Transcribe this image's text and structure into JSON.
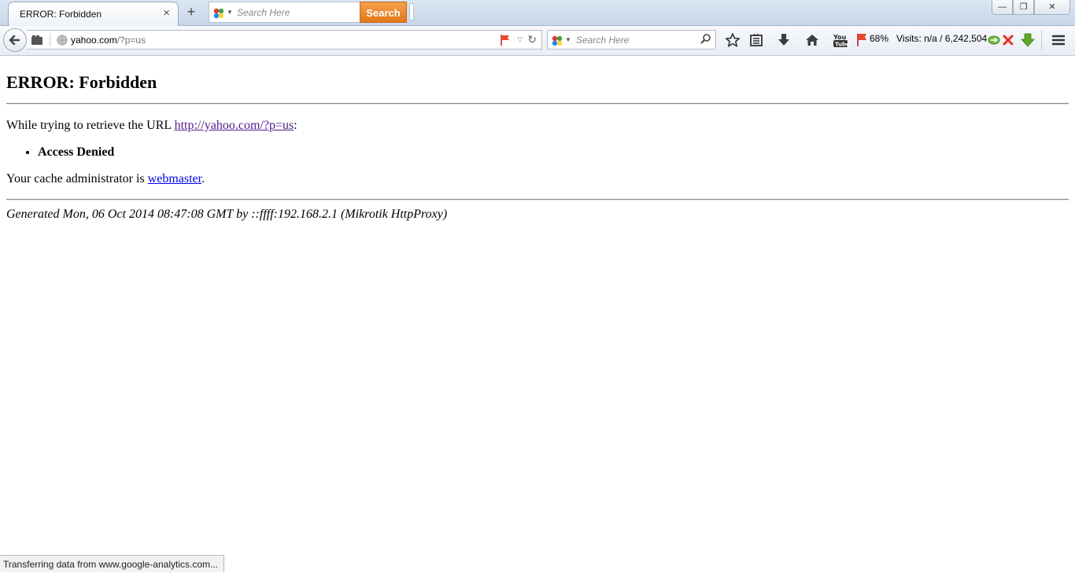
{
  "tab": {
    "title": "ERROR: Forbidden",
    "close_glyph": "×",
    "new_tab_glyph": "+"
  },
  "tab_search": {
    "placeholder": "Search Here",
    "button_label": "Search",
    "button_color": "#e98b2f"
  },
  "window_controls": {
    "minimize": "—",
    "restore": "❐",
    "close": "✕"
  },
  "address_bar": {
    "host": "yahoo.com",
    "path": "/?p=us"
  },
  "nav_search": {
    "placeholder": "Search Here"
  },
  "toolbar": {
    "icons": [
      "back-icon",
      "tab-groups-icon",
      "globe-icon",
      "report-flag-icon",
      "reload-icon",
      "bookmark-star-icon",
      "reading-list-icon",
      "downloads-icon",
      "home-icon",
      "youtube-icon",
      "red-flag-icon",
      "download-green-icon",
      "hamburger-menu-icon"
    ],
    "flag_percent": "68%",
    "visits_text": "Visits: n/a / 6,242,504"
  },
  "page": {
    "heading": "ERROR: Forbidden",
    "retrieve_prefix": "While trying to retrieve the URL ",
    "retrieve_url": "http://yahoo.com/?p=us",
    "retrieve_suffix": ":",
    "reason": "Access Denied",
    "admin_prefix": "Your cache administrator is ",
    "admin_link": "webmaster",
    "admin_suffix": ".",
    "footer": "Generated Mon, 06 Oct 2014 08:47:08 GMT by ::ffff:192.168.2.1 (Mikrotik HttpProxy)"
  },
  "status_bar": {
    "text": "Transferring data from www.google-analytics.com..."
  }
}
